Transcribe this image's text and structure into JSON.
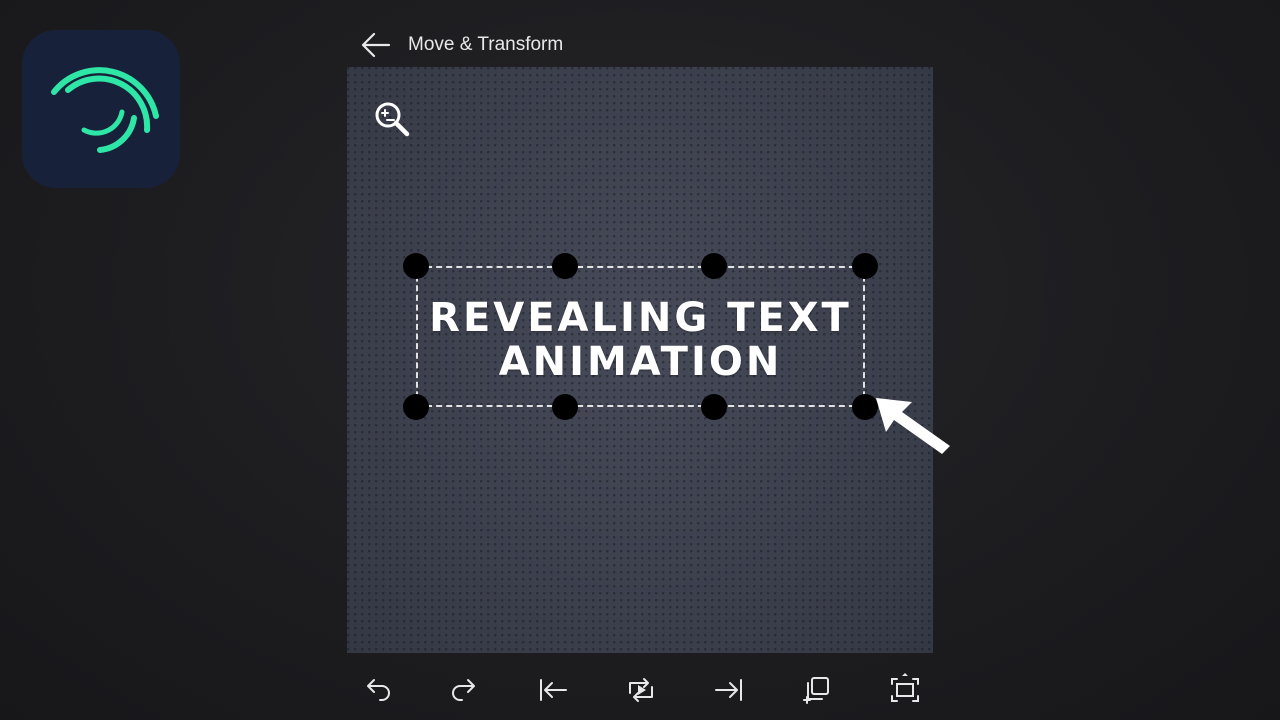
{
  "header": {
    "title": "Move & Transform",
    "back_icon": "arrow-left-icon"
  },
  "canvas": {
    "text_lines": [
      "REVEALING TEXT",
      "ANIMATION"
    ],
    "zoom_icon": "zoom-icon"
  },
  "toolbar": {
    "icons": [
      "undo-icon",
      "redo-icon",
      "jump-to-start-icon",
      "loop-play-icon",
      "jump-to-end-icon",
      "duplicate-icon",
      "fullscreen-icon"
    ]
  },
  "colors": {
    "accent": "#2ee6a6",
    "logo_bg": "#17223a",
    "canvas_bg": "#3e4250"
  }
}
